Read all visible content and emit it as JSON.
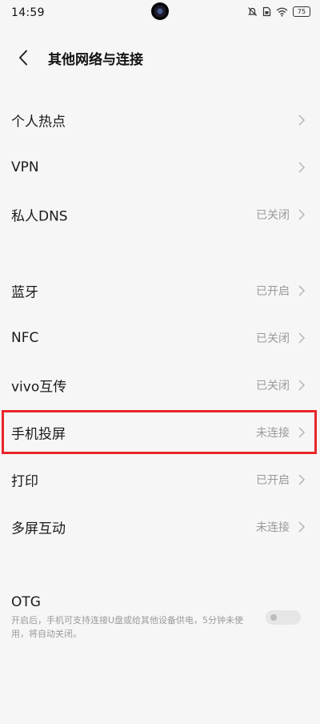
{
  "status": {
    "time": "14:59",
    "battery": "75",
    "icons": [
      "mute-icon",
      "sim-icon",
      "wifi-icon",
      "battery-icon"
    ]
  },
  "header": {
    "title": "其他网络与连接",
    "back_icon": "chevron-left-icon"
  },
  "items": [
    {
      "label": "个人热点",
      "value": ""
    },
    {
      "label": "VPN",
      "value": ""
    },
    {
      "label": "私人DNS",
      "value": "已关闭"
    },
    {
      "label": "蓝牙",
      "value": "已开启"
    },
    {
      "label": "NFC",
      "value": "已关闭"
    },
    {
      "label": "vivo互传",
      "value": "已关闭"
    },
    {
      "label": "手机投屏",
      "value": "未连接"
    },
    {
      "label": "打印",
      "value": "已开启"
    },
    {
      "label": "多屏互动",
      "value": "未连接"
    }
  ],
  "otg": {
    "label": "OTG",
    "description": "开启后，手机可支持连接U盘或给其他设备供电，5分钟未使用，将自动关闭。",
    "enabled": false
  },
  "colors": {
    "background": "#f6f6f6",
    "highlight": "#e8262a",
    "secondary_text": "#9a9a9a"
  }
}
